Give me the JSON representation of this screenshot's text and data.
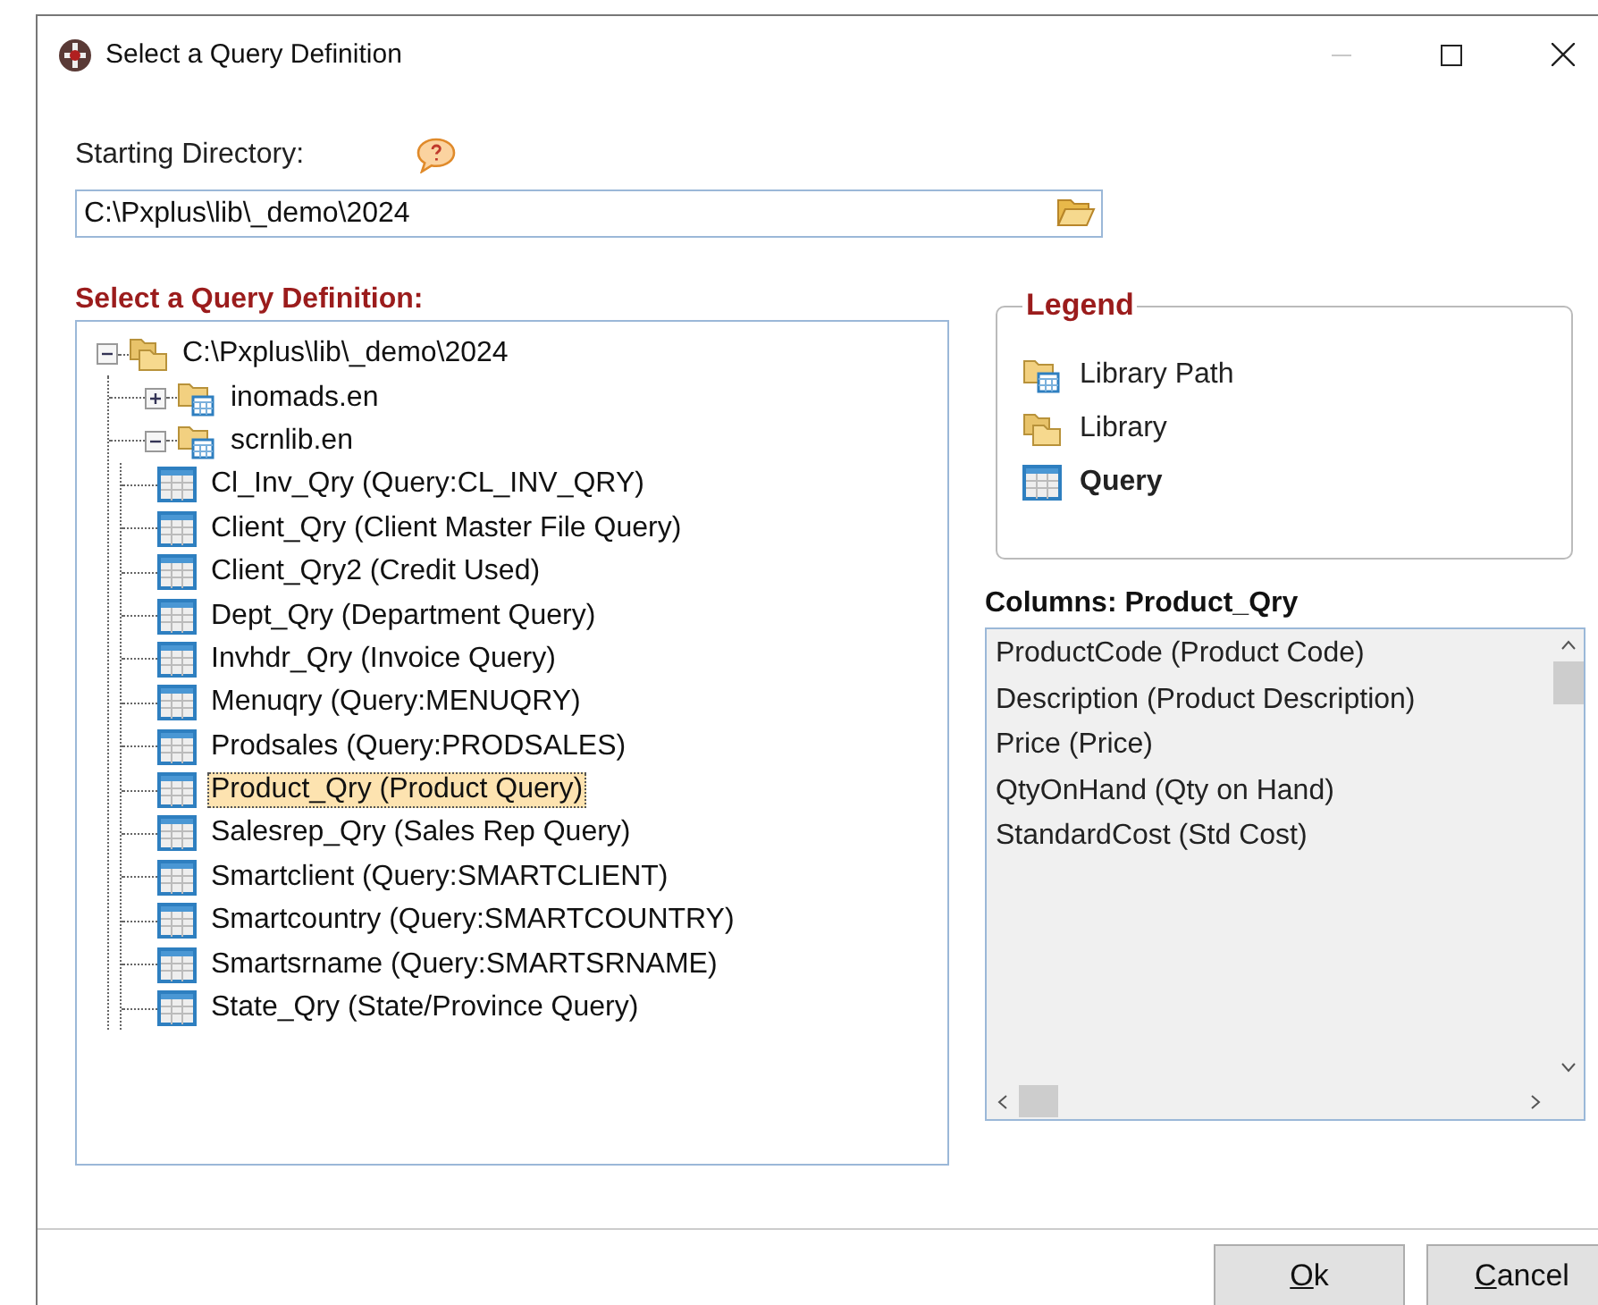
{
  "window": {
    "title": "Select a Query Definition",
    "controls": [
      {
        "kind": "minimize",
        "disabled": true
      },
      {
        "kind": "maximize",
        "disabled": false
      },
      {
        "kind": "close",
        "disabled": false
      }
    ]
  },
  "starting_directory": {
    "label": "Starting Directory:",
    "value": "C:\\Pxplus\\lib\\_demo\\2024"
  },
  "tree_title": "Select a Query Definition:",
  "tree": {
    "items": [
      {
        "kind": "library",
        "label": "C:\\Pxplus\\lib\\_demo\\2024",
        "expanded": true,
        "children": [
          {
            "kind": "library_path",
            "label": "inomads.en",
            "expanded": false
          },
          {
            "kind": "library_path",
            "label": "scrnlib.en",
            "expanded": true,
            "children": [
              {
                "kind": "query",
                "label": "Cl_Inv_Qry (Query:CL_INV_QRY)",
                "selected": false
              },
              {
                "kind": "query",
                "label": "Client_Qry (Client Master File Query)",
                "selected": false
              },
              {
                "kind": "query",
                "label": "Client_Qry2 (Credit Used)",
                "selected": false
              },
              {
                "kind": "query",
                "label": "Dept_Qry (Department Query)",
                "selected": false
              },
              {
                "kind": "query",
                "label": "Invhdr_Qry (Invoice Query)",
                "selected": false
              },
              {
                "kind": "query",
                "label": "Menuqry (Query:MENUQRY)",
                "selected": false
              },
              {
                "kind": "query",
                "label": "Prodsales (Query:PRODSALES)",
                "selected": false
              },
              {
                "kind": "query",
                "label": "Product_Qry (Product Query)",
                "selected": true
              },
              {
                "kind": "query",
                "label": "Salesrep_Qry (Sales Rep Query)",
                "selected": false
              },
              {
                "kind": "query",
                "label": "Smartclient (Query:SMARTCLIENT)",
                "selected": false
              },
              {
                "kind": "query",
                "label": "Smartcountry (Query:SMARTCOUNTRY)",
                "selected": false
              },
              {
                "kind": "query",
                "label": "Smartsrname (Query:SMARTSRNAME)",
                "selected": false
              },
              {
                "kind": "query",
                "label": "State_Qry (State/Province Query)",
                "selected": false
              }
            ]
          }
        ]
      }
    ]
  },
  "legend": {
    "title": "Legend",
    "items": [
      {
        "kind": "library_path",
        "label": "Library Path",
        "emphasized": false
      },
      {
        "kind": "library",
        "label": "Library",
        "emphasized": false
      },
      {
        "kind": "query",
        "label": "Query",
        "emphasized": true
      }
    ]
  },
  "columns": {
    "title": "Columns: Product_Qry",
    "items": [
      "ProductCode (Product Code)",
      "Description (Product Description)",
      "Price (Price)",
      "QtyOnHand (Qty on Hand)",
      "StandardCost (Std Cost)"
    ]
  },
  "buttons": [
    {
      "label": "Ok",
      "underline_first": true
    },
    {
      "label": "Cancel",
      "underline_first": true
    }
  ]
}
